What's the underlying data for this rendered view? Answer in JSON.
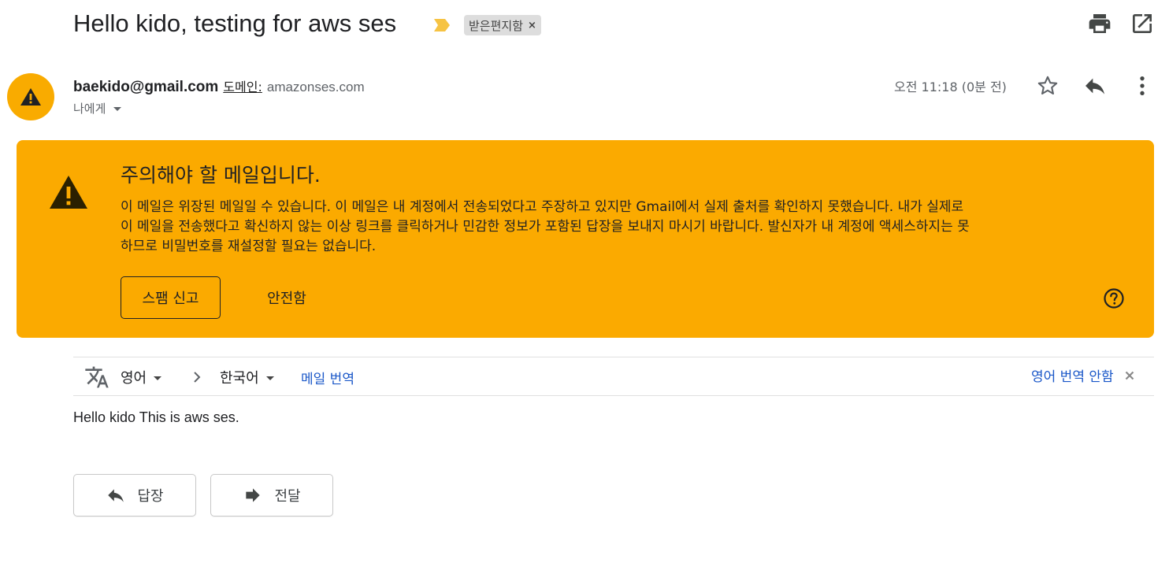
{
  "header": {
    "subject": "Hello kido, testing for aws ses",
    "label_chip": "받은편지함",
    "label_chip_close": "×",
    "importance_color": "#f6c343"
  },
  "sender": {
    "email": "baekido@gmail.com",
    "domain_label": "도메인:",
    "domain_value": "amazonses.com",
    "to": "나에게",
    "timestamp": "오전 11:18 (0분 전)",
    "avatar_color": "#f9ab00",
    "avatar_icon": "warning-icon"
  },
  "warning": {
    "title": "주의해야 할 메일입니다.",
    "body": "이 메일은 위장된 메일일 수 있습니다. 이 메일은 내 계정에서 전송되었다고 주장하고 있지만 Gmail에서 실제 출처를 확인하지 못했습니다. 내가 실제로 이 메일을 전송했다고 확신하지 않는 이상 링크를 클릭하거나 민감한 정보가 포함된 답장을 보내지 마시기 바랍니다. 발신자가 내 계정에 액세스하지는 못하므로 비밀번호를 재설정할 필요는 없습니다.",
    "spam_button": "스팸 신고",
    "safe_button": "안전함",
    "background_color": "#fbaa00"
  },
  "translate": {
    "from_language": "영어",
    "to_language": "한국어",
    "translate_link": "메일 번역",
    "no_translate_link": "영어 번역 안함",
    "link_color": "#1a57c8"
  },
  "message": {
    "body": "Hello kido This is aws ses."
  },
  "actions": {
    "reply_label": "답장",
    "forward_label": "전달"
  }
}
